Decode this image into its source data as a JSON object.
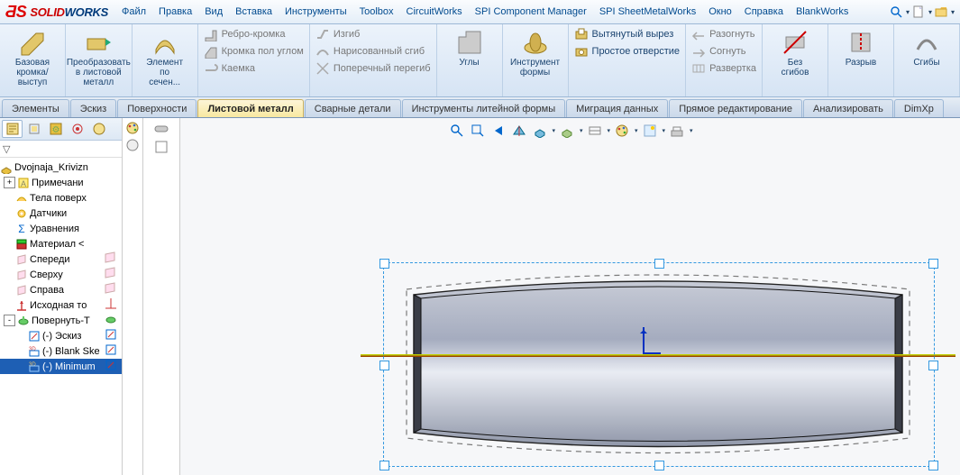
{
  "app": {
    "brand_solid": "SOLID",
    "brand_works": "WORKS"
  },
  "menu": {
    "items": [
      "Файл",
      "Правка",
      "Вид",
      "Вставка",
      "Инструменты",
      "Toolbox",
      "CircuitWorks",
      "SPI Component Manager",
      "SPI SheetMetalWorks",
      "Окно",
      "Справка",
      "BlankWorks"
    ]
  },
  "menu_right_icons": [
    "search-icon",
    "new-doc-icon",
    "open-doc-icon"
  ],
  "ribbon": {
    "big_groups": [
      {
        "label": "Базовая\nкромка/выступ",
        "icon": "base-flange-icon"
      },
      {
        "label": "Преобразовать\nв листовой\nметалл",
        "icon": "convert-sm-icon"
      },
      {
        "label": "Элемент\nпо\nсечен...",
        "icon": "loft-icon"
      }
    ],
    "col1": [
      {
        "label": "Ребро-кромка",
        "icon": "edge-flange-icon"
      },
      {
        "label": "Кромка пол углом",
        "icon": "miter-flange-icon"
      },
      {
        "label": "Каемка",
        "icon": "hem-icon"
      }
    ],
    "col2": [
      {
        "label": "Изгиб",
        "icon": "jog-icon"
      },
      {
        "label": "Нарисованный сгиб",
        "icon": "sketched-bend-icon"
      },
      {
        "label": "Поперечный перегиб",
        "icon": "cross-break-icon"
      }
    ],
    "mid_big": [
      {
        "label": "Углы",
        "icon": "corners-icon"
      },
      {
        "label": "Инструмент\nформы",
        "icon": "forming-tool-icon"
      }
    ],
    "col3": [
      {
        "label": "Вытянутый вырез",
        "icon": "extruded-cut-icon",
        "enabled": true
      },
      {
        "label": "Простое отверстие",
        "icon": "simple-hole-icon",
        "enabled": true
      }
    ],
    "col4": [
      {
        "label": "Разогнуть",
        "icon": "unfold-icon"
      },
      {
        "label": "Согнуть",
        "icon": "fold-icon"
      },
      {
        "label": "Развертка",
        "icon": "flat-pattern-icon"
      }
    ],
    "end_big": [
      {
        "label": "Без\nсгибов",
        "icon": "no-bends-icon"
      },
      {
        "label": "Разрыв",
        "icon": "rip-icon"
      },
      {
        "label": "Сгибы",
        "icon": "bends-icon"
      }
    ]
  },
  "tabs": [
    "Элементы",
    "Эскиз",
    "Поверхности",
    "Листовой металл",
    "Сварные детали",
    "Инструменты литейной формы",
    "Миграция данных",
    "Прямое редактирование",
    "Анализировать",
    "DimXp"
  ],
  "tabs_active_index": 3,
  "sidepanel_tab_icons": [
    "fm-tree-icon",
    "config-icon",
    "property-icon",
    "target-icon",
    "appearances-icon"
  ],
  "sidepanel_tab_icons2": [
    "filter-funnel-icon",
    "rebuild-icon",
    "expand-icon"
  ],
  "filter_placeholder": "▽",
  "tree": [
    {
      "depth": 0,
      "toggle": "",
      "icon": "part-icon",
      "label": "Dvojnaja_Krivizn",
      "ricon": ""
    },
    {
      "depth": 1,
      "toggle": "+",
      "icon": "annotations-icon",
      "label": "Примечани",
      "ricon": ""
    },
    {
      "depth": 1,
      "toggle": "",
      "icon": "surface-bodies-icon",
      "label": "Тела поверх",
      "ricon": ""
    },
    {
      "depth": 1,
      "toggle": "",
      "icon": "sensors-icon",
      "label": "Датчики",
      "ricon": ""
    },
    {
      "depth": 1,
      "toggle": "",
      "icon": "equations-icon",
      "label": "Уравнения",
      "ricon": ""
    },
    {
      "depth": 1,
      "toggle": "",
      "icon": "material-icon",
      "label": "Материал <",
      "ricon": ""
    },
    {
      "depth": 1,
      "toggle": "",
      "icon": "plane-icon",
      "label": "Спереди",
      "ricon": "plane-small-icon"
    },
    {
      "depth": 1,
      "toggle": "",
      "icon": "plane-icon",
      "label": "Сверху",
      "ricon": "plane-small-icon"
    },
    {
      "depth": 1,
      "toggle": "",
      "icon": "plane-icon",
      "label": "Справа",
      "ricon": "plane-small-icon"
    },
    {
      "depth": 1,
      "toggle": "",
      "icon": "origin-icon",
      "label": "Исходная то",
      "ricon": "origin-small-icon"
    },
    {
      "depth": 1,
      "toggle": "-",
      "icon": "revolve-icon",
      "label": "Повернуть-Т",
      "ricon": "revolve-small-icon"
    },
    {
      "depth": 2,
      "toggle": "",
      "icon": "sketch-icon",
      "label": "(-) Эскиз",
      "ricon": "sketch-small-icon"
    },
    {
      "depth": 2,
      "toggle": "",
      "icon": "sketch3d-icon",
      "label": "(-) Blank Ske",
      "ricon": "sketch-small-icon"
    },
    {
      "depth": 2,
      "toggle": "",
      "icon": "sketch3d-icon",
      "label": "(-) Minimum",
      "ricon": "sketch-small-icon",
      "selected": true
    }
  ],
  "midcol_icons": [
    "hide-show-icon",
    "box-placeholder-icon"
  ],
  "view_toolbar": [
    "zoom-fit-icon",
    "zoom-area-icon",
    "prev-view-icon",
    "section-icon",
    "view-orient-icon",
    "display-style-icon",
    "hide-show-items-icon",
    "edit-appearance-icon",
    "apply-scene-icon",
    "view-settings-icon"
  ]
}
